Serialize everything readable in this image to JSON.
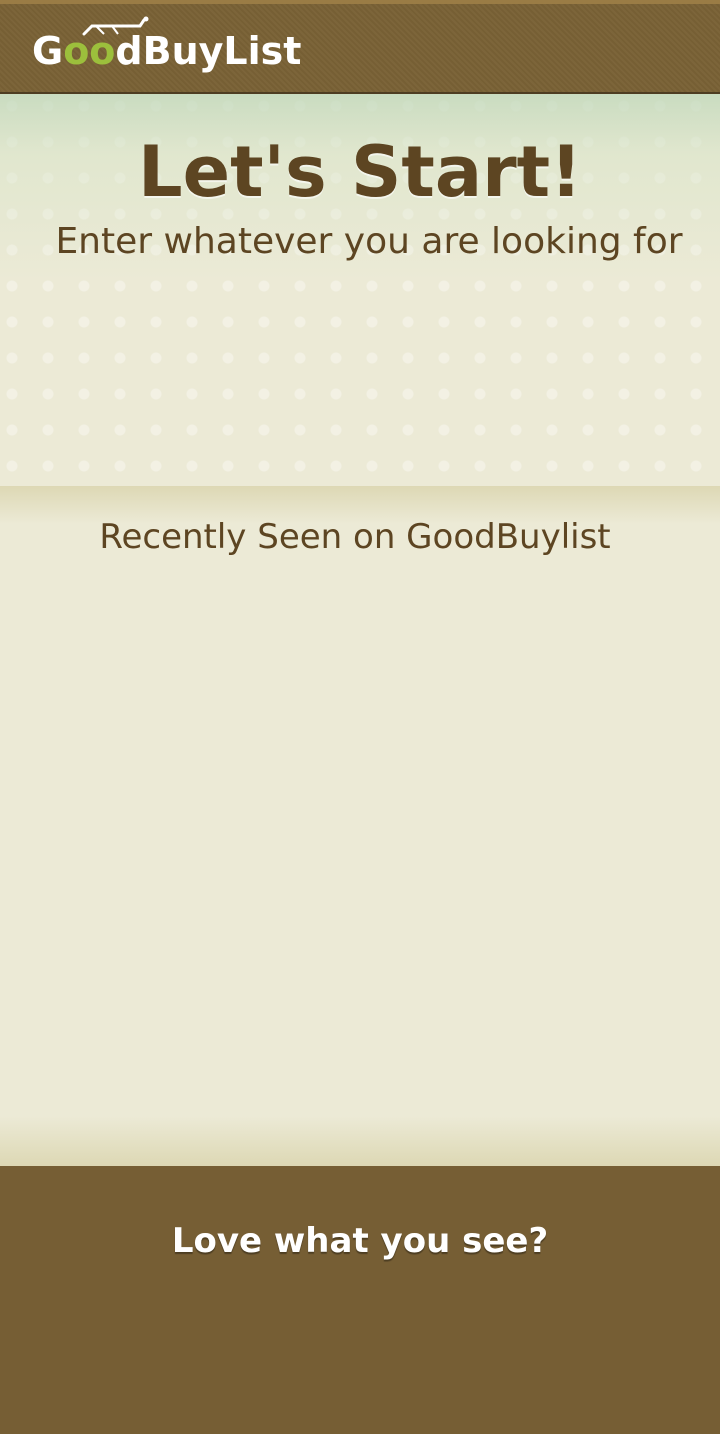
{
  "header": {
    "logo": {
      "part1": "G",
      "part2": "oo",
      "part3": "dBuyList",
      "accent_color": "#9cbf3c",
      "icon": "shopping-cart-icon"
    }
  },
  "hero": {
    "title": "Let's Start!",
    "subtitle": "Enter whatever you are looking for"
  },
  "recent": {
    "title": "Recently Seen on GoodBuylist"
  },
  "footer": {
    "title": "Love what you see?"
  },
  "colors": {
    "header_bg": "#7a6236",
    "page_bg": "#ecead6",
    "text_brown": "#5d4522",
    "footer_bg": "#765e34"
  }
}
